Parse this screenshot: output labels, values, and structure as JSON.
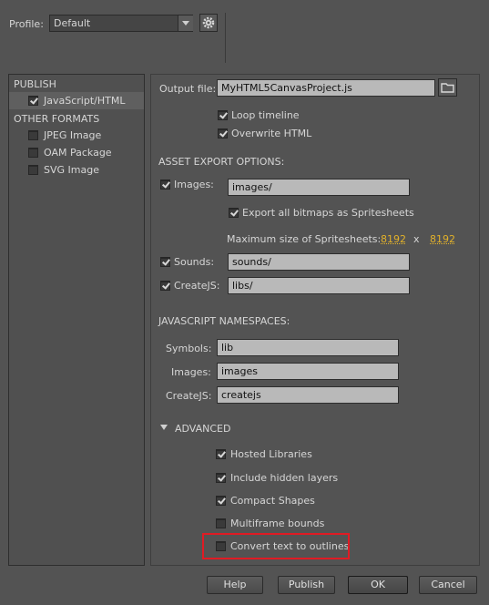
{
  "profile": {
    "label": "Profile:",
    "value": "Default"
  },
  "sidebar": {
    "publish_header": "PUBLISH",
    "publish_items": [
      {
        "label": "JavaScript/HTML",
        "checked": true
      }
    ],
    "other_header": "OTHER FORMATS",
    "other_items": [
      {
        "label": "JPEG Image",
        "checked": false
      },
      {
        "label": "OAM Package",
        "checked": false
      },
      {
        "label": "SVG Image",
        "checked": false
      }
    ]
  },
  "output": {
    "label": "Output file:",
    "value": "MyHTML5CanvasProject.js"
  },
  "options": {
    "loop_timeline": "Loop timeline",
    "overwrite_html": "Overwrite HTML"
  },
  "asset_export": {
    "header": "ASSET EXPORT OPTIONS:",
    "images_label": "Images:",
    "images_value": "images/",
    "export_spritesheets": "Export all bitmaps as Spritesheets",
    "max_size_label": "Maximum size of Spritesheets:",
    "max_w": "8192",
    "x": "x",
    "max_h": "8192",
    "sounds_label": "Sounds:",
    "sounds_value": "sounds/",
    "createjs_label": "CreateJS:",
    "createjs_value": "libs/"
  },
  "namespaces": {
    "header": "JAVASCRIPT NAMESPACES:",
    "symbols_label": "Symbols:",
    "symbols_value": "lib",
    "images_label": "Images:",
    "images_value": "images",
    "createjs_label": "CreateJS:",
    "createjs_value": "createjs"
  },
  "advanced": {
    "header": "ADVANCED",
    "items": [
      {
        "label": "Hosted Libraries",
        "checked": true
      },
      {
        "label": "Include hidden layers",
        "checked": true
      },
      {
        "label": "Compact Shapes",
        "checked": true
      },
      {
        "label": "Multiframe bounds",
        "checked": false
      },
      {
        "label": "Convert text to outlines",
        "checked": false
      }
    ]
  },
  "buttons": {
    "help": "Help",
    "publish": "Publish",
    "ok": "OK",
    "cancel": "Cancel"
  }
}
